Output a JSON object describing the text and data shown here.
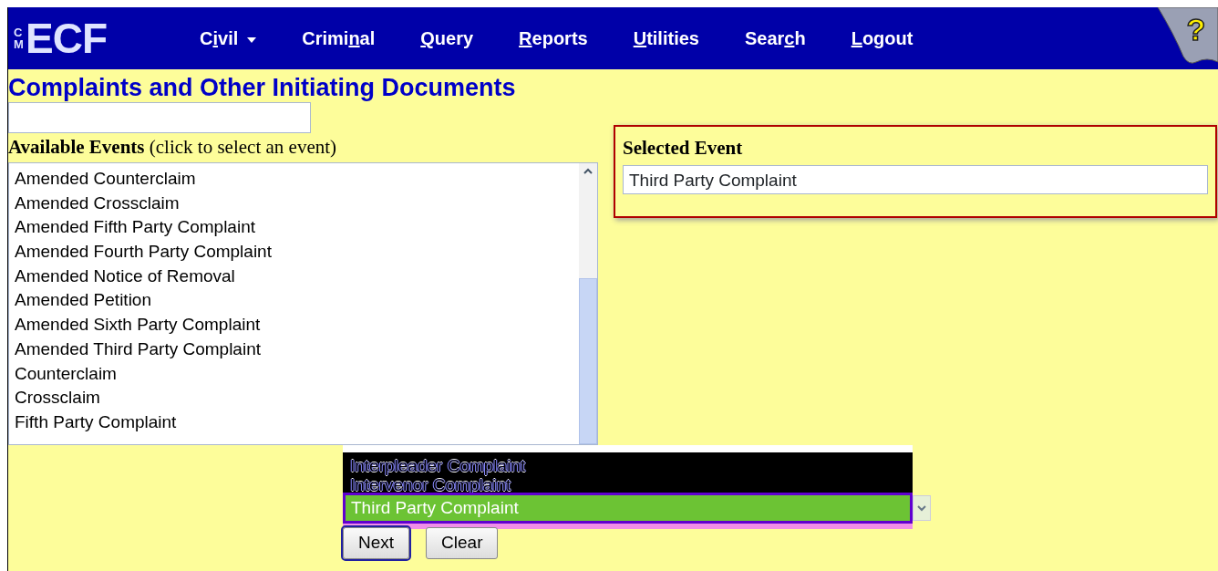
{
  "logo": {
    "small": "CM",
    "big": "ECF"
  },
  "menu": [
    {
      "label_start": "C",
      "access_key": "i",
      "label_end": "vil",
      "dropdown": true
    },
    {
      "label_start": "Crimi",
      "access_key": "n",
      "label_end": "al",
      "dropdown": false
    },
    {
      "access_key": "Q",
      "label_end": "uery",
      "dropdown": false
    },
    {
      "access_key": "R",
      "label_end": "eports",
      "dropdown": false
    },
    {
      "access_key": "U",
      "label_end": "tilities",
      "dropdown": false
    },
    {
      "label_start": "Sear",
      "access_key": "c",
      "label_end": "h",
      "dropdown": false
    },
    {
      "access_key": "L",
      "label_end": "ogout",
      "dropdown": false
    }
  ],
  "help": "?",
  "page_title": "Complaints and Other Initiating Documents",
  "available_events": {
    "label": "**Available Events** (click to select an event)",
    "items": [
      "Amended Counterclaim",
      "Amended Crossclaim",
      "Amended Fifth Party Complaint",
      "Amended Fourth Party Complaint",
      "Amended Notice of Removal",
      "Amended Petition",
      "Amended Sixth Party Complaint",
      "Amended Third Party Complaint",
      "Counterclaim",
      "Crossclaim",
      "Fifth Party Complaint"
    ]
  },
  "selected_event": {
    "label": "Selected Event",
    "value": "Third Party Complaint"
  },
  "dropdown": {
    "options": [
      "Interpleader Complaint",
      "Intervenor Complaint"
    ],
    "value": "Third Party Complaint"
  },
  "buttons": [
    "Next",
    "Clear"
  ]
}
